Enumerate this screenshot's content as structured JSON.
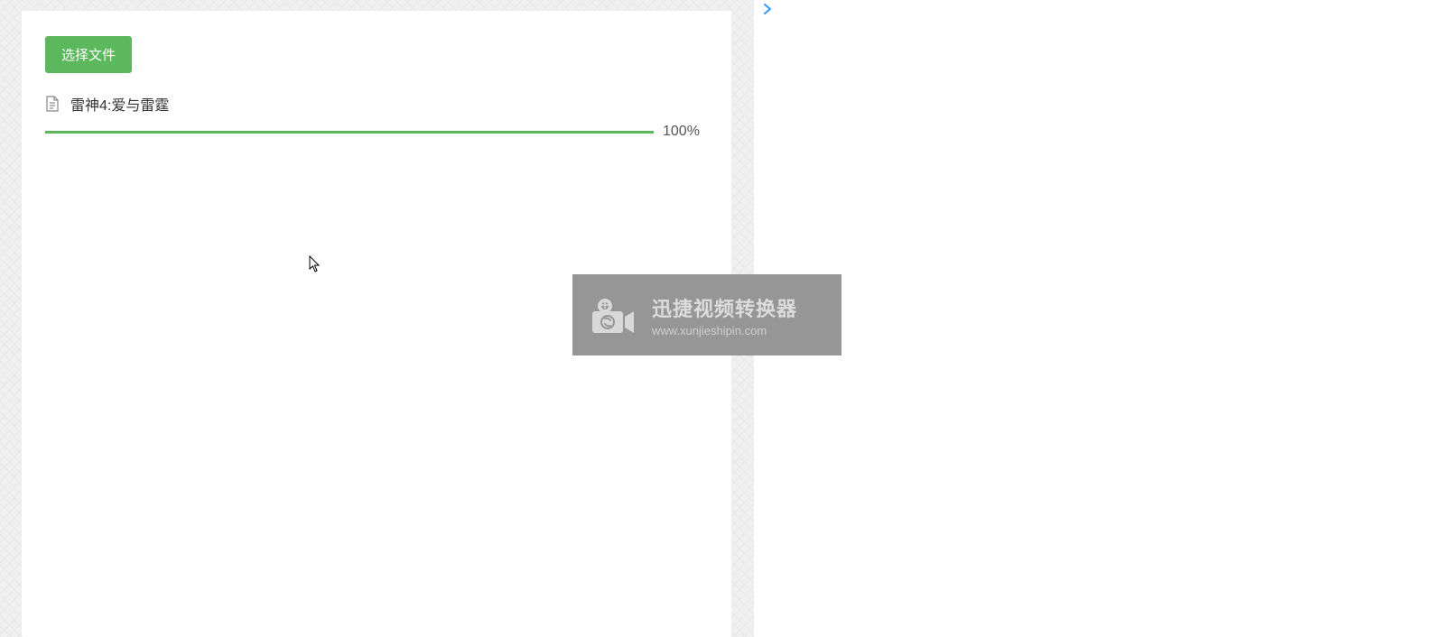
{
  "buttons": {
    "select_file": "选择文件"
  },
  "file": {
    "name": "雷神4:爱与雷霆",
    "progress_percent": "100%",
    "progress_value": 100
  },
  "watermark": {
    "title": "迅捷视频转换器",
    "url": "www.xunjieshipin.com"
  },
  "colors": {
    "primary_green": "#5cb85c",
    "link_blue": "#3399ff",
    "watermark_bg": "#969696"
  }
}
